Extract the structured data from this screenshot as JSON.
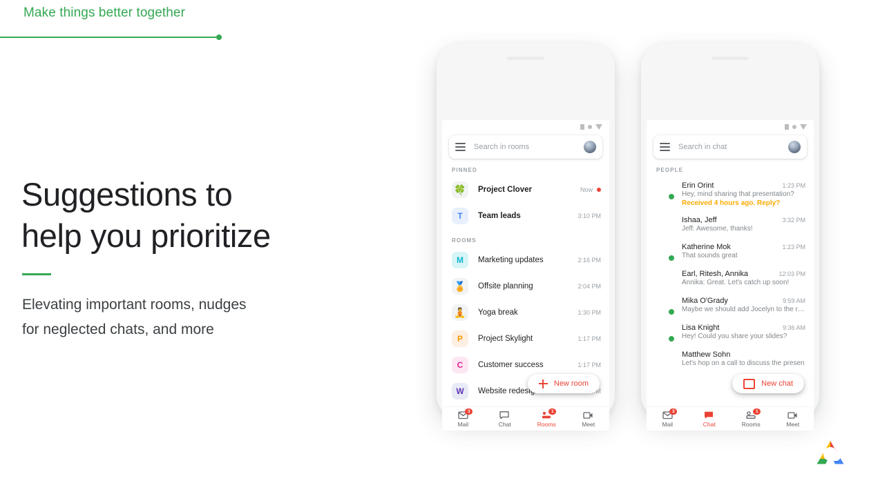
{
  "slide": {
    "eyebrow": "Make things better together",
    "headline_line1": "Suggestions to",
    "headline_line2": "help you prioritize",
    "subhead_line1": "Elevating important rooms, nudges",
    "subhead_line2": "for neglected chats, and more",
    "accent_green": "#34a853",
    "accent_red": "#ea4335",
    "nudge_amber": "#f9ab00"
  },
  "phone_rooms": {
    "search": {
      "placeholder": "Search in rooms",
      "menu_icon": "hamburger-icon",
      "avatar_icon": "user-avatar-icon"
    },
    "status_icons": [
      "battery-icon",
      "wifi-icon",
      "signal-icon"
    ],
    "sections": [
      {
        "label": "PINNED",
        "items": [
          {
            "avatar_text": "🍀",
            "avatar_bg": "#f1f3f4",
            "avatar_color": "#34a853",
            "title": "Project Clover",
            "time": "Now",
            "unread": true,
            "bold": true
          },
          {
            "avatar_text": "T",
            "avatar_bg": "#e8f0fe",
            "avatar_color": "#4285f4",
            "title": "Team leads",
            "time": "3:10 PM",
            "unread": false,
            "bold": true
          }
        ]
      },
      {
        "label": "ROOMS",
        "items": [
          {
            "avatar_text": "M",
            "avatar_bg": "#d7f5f7",
            "avatar_color": "#12b5cb",
            "title": "Marketing updates",
            "time": "2:16 PM",
            "unread": false,
            "bold": false
          },
          {
            "avatar_text": "🏅",
            "avatar_bg": "#f1f3f4",
            "avatar_color": "#5f6368",
            "title": "Offsite planning",
            "time": "2:04 PM",
            "unread": false,
            "bold": false
          },
          {
            "avatar_text": "🧘",
            "avatar_bg": "#f1f3f4",
            "avatar_color": "#5f6368",
            "title": "Yoga break",
            "time": "1:30 PM",
            "unread": false,
            "bold": false
          },
          {
            "avatar_text": "P",
            "avatar_bg": "#feefe3",
            "avatar_color": "#f29900",
            "title": "Project Skylight",
            "time": "1:17 PM",
            "unread": false,
            "bold": false
          },
          {
            "avatar_text": "C",
            "avatar_bg": "#fde7f3",
            "avatar_color": "#e52592",
            "title": "Customer success",
            "time": "1:17 PM",
            "unread": false,
            "bold": false
          },
          {
            "avatar_text": "W",
            "avatar_bg": "#e8eaf6",
            "avatar_color": "#5e35b1",
            "title": "Website redesign",
            "time": "1:17 PM",
            "unread": false,
            "bold": false
          }
        ]
      }
    ],
    "fab": {
      "label": "New room",
      "icon": "plus-icon"
    },
    "nav": [
      {
        "label": "Mail",
        "icon": "mail-icon",
        "badge": "3",
        "active": false
      },
      {
        "label": "Chat",
        "icon": "chat-bubble-icon",
        "badge": "",
        "active": false
      },
      {
        "label": "Rooms",
        "icon": "rooms-icon",
        "badge": "1",
        "active": true
      },
      {
        "label": "Meet",
        "icon": "video-camera-icon",
        "badge": "",
        "active": false
      }
    ]
  },
  "phone_chat": {
    "search": {
      "placeholder": "Search in chat",
      "menu_icon": "hamburger-icon",
      "avatar_icon": "user-avatar-icon"
    },
    "status_icons": [
      "battery-icon",
      "wifi-icon",
      "signal-icon"
    ],
    "section_label": "PEOPLE",
    "items": [
      {
        "name": "Erin Orint",
        "time": "1:23 PM",
        "preview": "Hey, mind sharing that presentation?",
        "nudge": "Received 4 hours ago. Reply?",
        "online": true,
        "avatar_from": "#e8c9b8",
        "avatar_to": "#8d5b43"
      },
      {
        "name": "Ishaa, Jeff",
        "time": "3:32 PM",
        "preview": "Jeff: Awesome, thanks!",
        "nudge": "",
        "online": false,
        "avatar_from": "#f5d36b",
        "avatar_to": "#c98a3c"
      },
      {
        "name": "Katherine Mok",
        "time": "1:23 PM",
        "preview": "That sounds great",
        "nudge": "",
        "online": true,
        "avatar_from": "#cfc6a8",
        "avatar_to": "#7b6f53"
      },
      {
        "name": "Earl, Ritesh, Annika",
        "time": "12:03 PM",
        "preview": "Annika: Great. Let's catch up soon!",
        "nudge": "",
        "online": false,
        "avatar_from": "#d8d2c6",
        "avatar_to": "#6b6257"
      },
      {
        "name": "Mika O'Grady",
        "time": "9:59 AM",
        "preview": "Maybe we should add Jocelyn to the ro…",
        "nudge": "",
        "online": true,
        "avatar_from": "#a8d28a",
        "avatar_to": "#4b7a3a"
      },
      {
        "name": "Lisa Knight",
        "time": "9:36 AM",
        "preview": "Hey! Could you share your slides?",
        "nudge": "",
        "online": true,
        "avatar_from": "#e0b9a0",
        "avatar_to": "#6d4a3a"
      },
      {
        "name": "Matthew Sohn",
        "time": "",
        "preview": "Let's hop on a call to discuss the presen",
        "nudge": "",
        "online": false,
        "avatar_from": "#e6c59a",
        "avatar_to": "#7a4b2c"
      }
    ],
    "fab": {
      "label": "New chat",
      "icon": "chat-bubble-outline-icon"
    },
    "nav": [
      {
        "label": "Mail",
        "icon": "mail-icon",
        "badge": "3",
        "active": false
      },
      {
        "label": "Chat",
        "icon": "chat-bubble-icon",
        "badge": "",
        "active": true
      },
      {
        "label": "Rooms",
        "icon": "rooms-icon",
        "badge": "1",
        "active": false
      },
      {
        "label": "Meet",
        "icon": "video-camera-icon",
        "badge": "",
        "active": false
      }
    ]
  },
  "logo": {
    "name": "google-cloud-logo"
  }
}
